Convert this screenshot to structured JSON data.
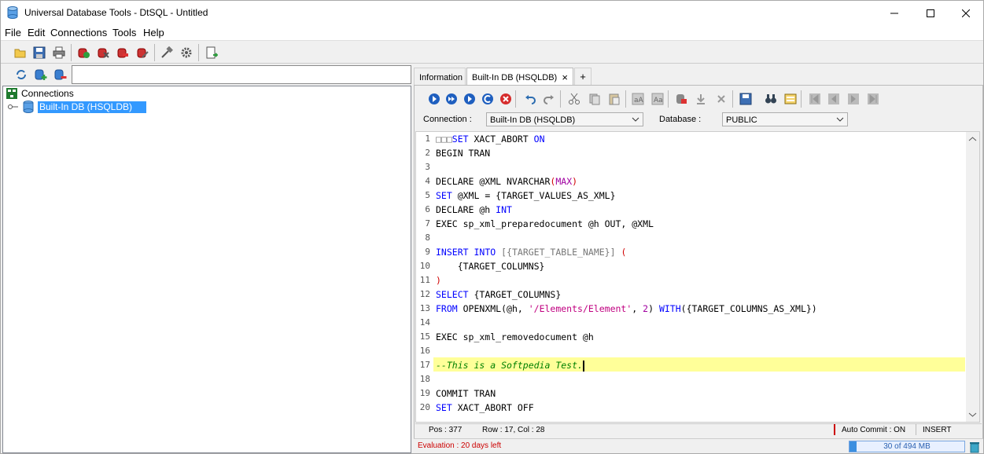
{
  "window": {
    "title": "Universal Database Tools - DtSQL - Untitled"
  },
  "menu": [
    "File",
    "Edit",
    "Connections",
    "Tools",
    "Help"
  ],
  "tree": {
    "root": "Connections",
    "item": "Built-In DB (HSQLDB)"
  },
  "tabs": [
    {
      "label": "Information",
      "active": false
    },
    {
      "label": "Built-In DB (HSQLDB)",
      "active": true
    }
  ],
  "tab_close": "×",
  "tab_add": "+",
  "connection": {
    "label": "Connection :",
    "value": "Built-In DB (HSQLDB)",
    "db_label": "Database :",
    "db_value": "PUBLIC"
  },
  "editor": {
    "line_numbers": [
      "1",
      "2",
      "3",
      "4",
      "5",
      "6",
      "7",
      "8",
      "9",
      "10",
      "11",
      "12",
      "13",
      "14",
      "15",
      "16",
      "17",
      "18",
      "19",
      "20"
    ],
    "prefix_boxes": "□□□",
    "highlight_line": 17
  },
  "status": {
    "pos": "Pos : 377",
    "rowcol": "Row : 17,  Col : 28",
    "autocommit": "Auto Commit : ON",
    "mode": "INSERT"
  },
  "bottom": {
    "evaluation": "Evaluation : 20 days left",
    "memory": "30 of 494 MB",
    "memory_fraction": 0.06
  },
  "colors": {
    "keyword": "#0000ff",
    "string": "#c00080",
    "comment": "#008000",
    "selection": "#3399ff",
    "highlight": "#ffff99",
    "evaluation": "#cc0000"
  }
}
